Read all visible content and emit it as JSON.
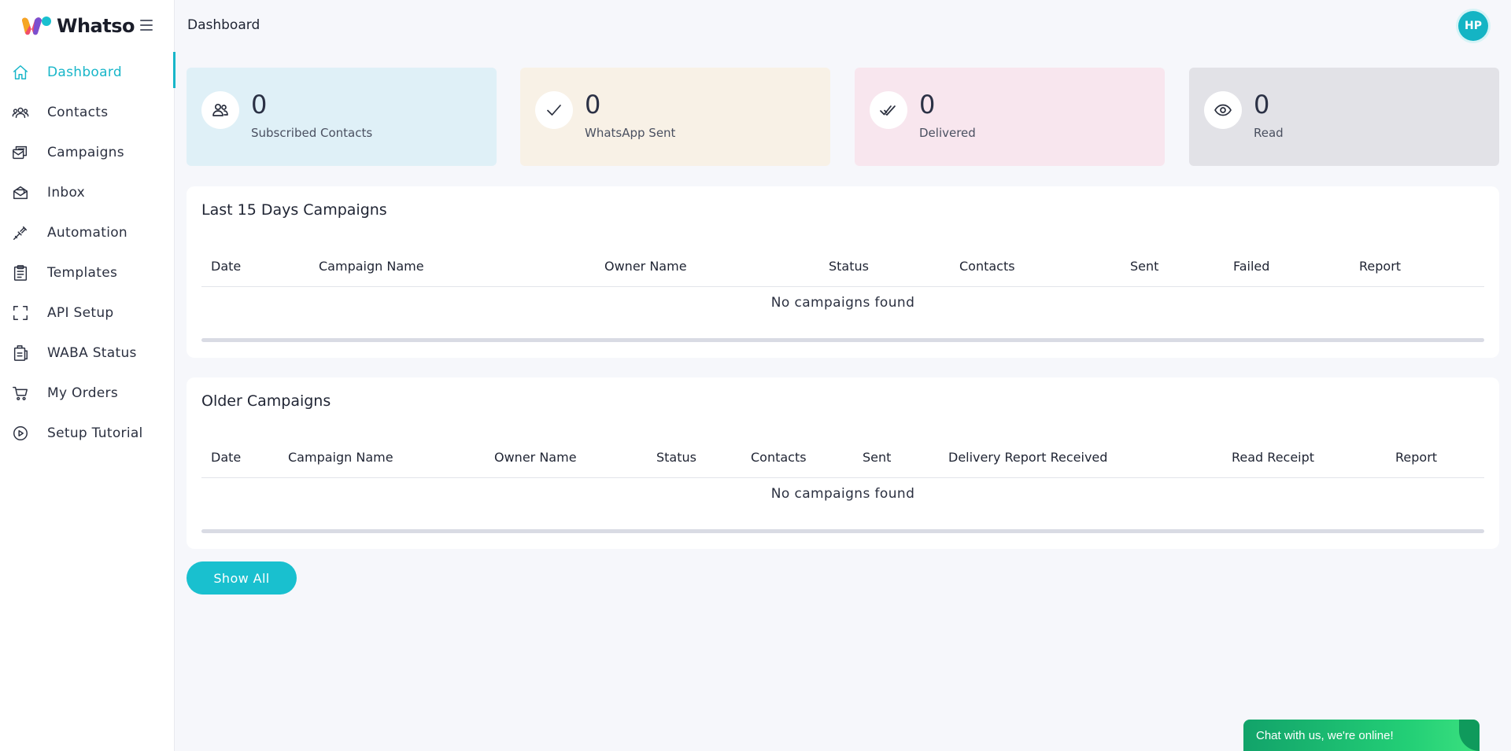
{
  "brand": {
    "name": "Whatso"
  },
  "sidebar": {
    "items": [
      {
        "label": "Dashboard",
        "icon": "home-icon",
        "active": true
      },
      {
        "label": "Contacts",
        "icon": "users-icon"
      },
      {
        "label": "Campaigns",
        "icon": "campaigns-icon"
      },
      {
        "label": "Inbox",
        "icon": "inbox-icon"
      },
      {
        "label": "Automation",
        "icon": "automation-icon"
      },
      {
        "label": "Templates",
        "icon": "templates-icon"
      },
      {
        "label": "API Setup",
        "icon": "api-icon"
      },
      {
        "label": "WABA Status",
        "icon": "waba-status-icon"
      },
      {
        "label": "My Orders",
        "icon": "cart-icon"
      },
      {
        "label": "Setup Tutorial",
        "icon": "play-icon"
      }
    ]
  },
  "header": {
    "title": "Dashboard",
    "avatar_initials": "HP"
  },
  "stats": [
    {
      "value": "0",
      "label": "Subscribed Contacts",
      "icon": "users-icon",
      "color": "#dff0f7"
    },
    {
      "value": "0",
      "label": "WhatsApp Sent",
      "icon": "check-icon",
      "color": "#f8f1e6"
    },
    {
      "value": "0",
      "label": "Delivered",
      "icon": "double-check-icon",
      "color": "#f8e6ee"
    },
    {
      "value": "0",
      "label": "Read",
      "icon": "eye-icon",
      "color": "#e2e2e7"
    }
  ],
  "recent_campaigns": {
    "title": "Last 15 Days Campaigns",
    "columns": [
      "Date",
      "Campaign Name",
      "Owner Name",
      "Status",
      "Contacts",
      "Sent",
      "Failed",
      "Report"
    ],
    "empty_message": "No campaigns found"
  },
  "older_campaigns": {
    "title": "Older Campaigns",
    "columns": [
      "Date",
      "Campaign Name",
      "Owner Name",
      "Status",
      "Contacts",
      "Sent",
      "Delivery Report Received",
      "Read Receipt",
      "Report"
    ],
    "empty_message": "No campaigns found"
  },
  "actions": {
    "show_all_label": "Show All"
  },
  "chat": {
    "label": "Chat with us, we're online!"
  },
  "colors": {
    "accent": "#18b6c9",
    "chat_green": "#23cf76"
  }
}
